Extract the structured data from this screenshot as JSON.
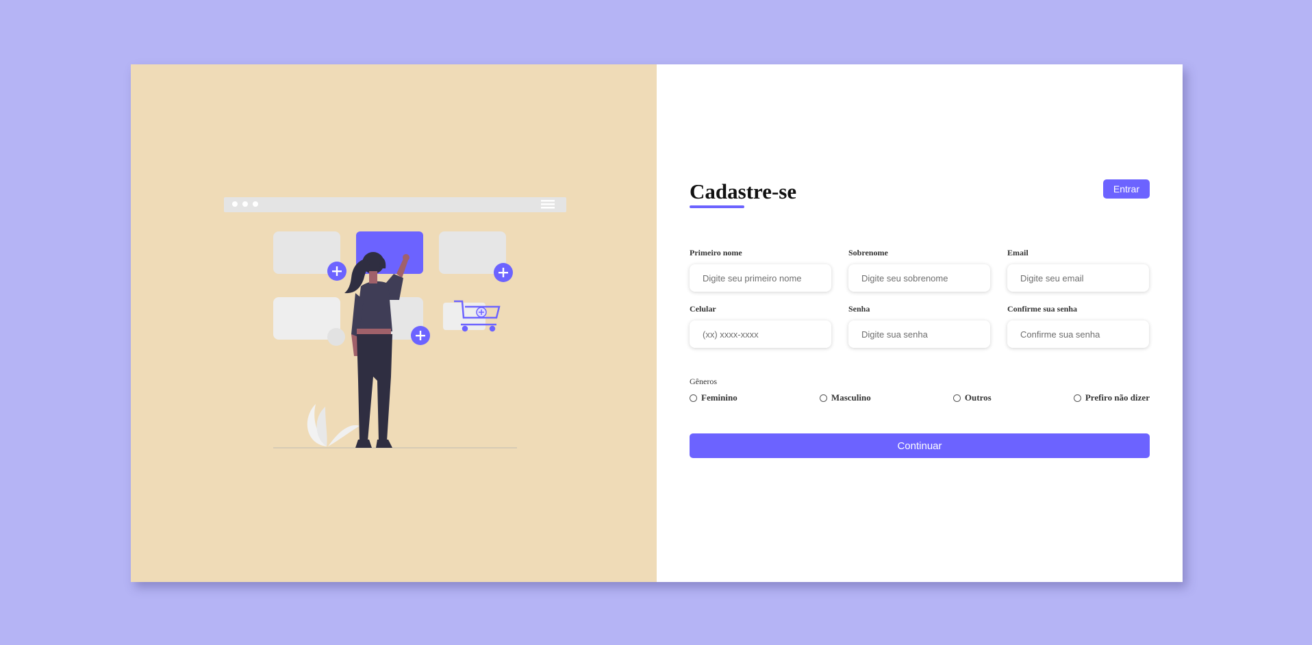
{
  "colors": {
    "page_background": "#b5b4f5",
    "illustration_panel": "#efdbb7",
    "accent": "#6c63ff",
    "card": "#ffffff"
  },
  "illustration": {
    "icons": [
      "browser-bar-icon",
      "menu-icon",
      "plus-icon",
      "shopping-cart-icon",
      "woman-figure",
      "plant-icon"
    ]
  },
  "header": {
    "title": "Cadastre-se",
    "login_label": "Entrar"
  },
  "fields": [
    {
      "label": "Primeiro nome",
      "placeholder": "Digite seu primeiro nome",
      "value": ""
    },
    {
      "label": "Sobrenome",
      "placeholder": "Digite seu sobrenome",
      "value": ""
    },
    {
      "label": "Email",
      "placeholder": "Digite seu email",
      "value": ""
    },
    {
      "label": "Celular",
      "placeholder": "(xx) xxxx-xxxx",
      "value": ""
    },
    {
      "label": "Senha",
      "placeholder": "Digite sua senha",
      "value": ""
    },
    {
      "label": "Confirme sua senha",
      "placeholder": "Confirme sua senha",
      "value": ""
    }
  ],
  "gender": {
    "title": "Gêneros",
    "options": [
      "Feminino",
      "Masculino",
      "Outros",
      "Prefiro não dizer"
    ]
  },
  "continue_label": "Continuar"
}
